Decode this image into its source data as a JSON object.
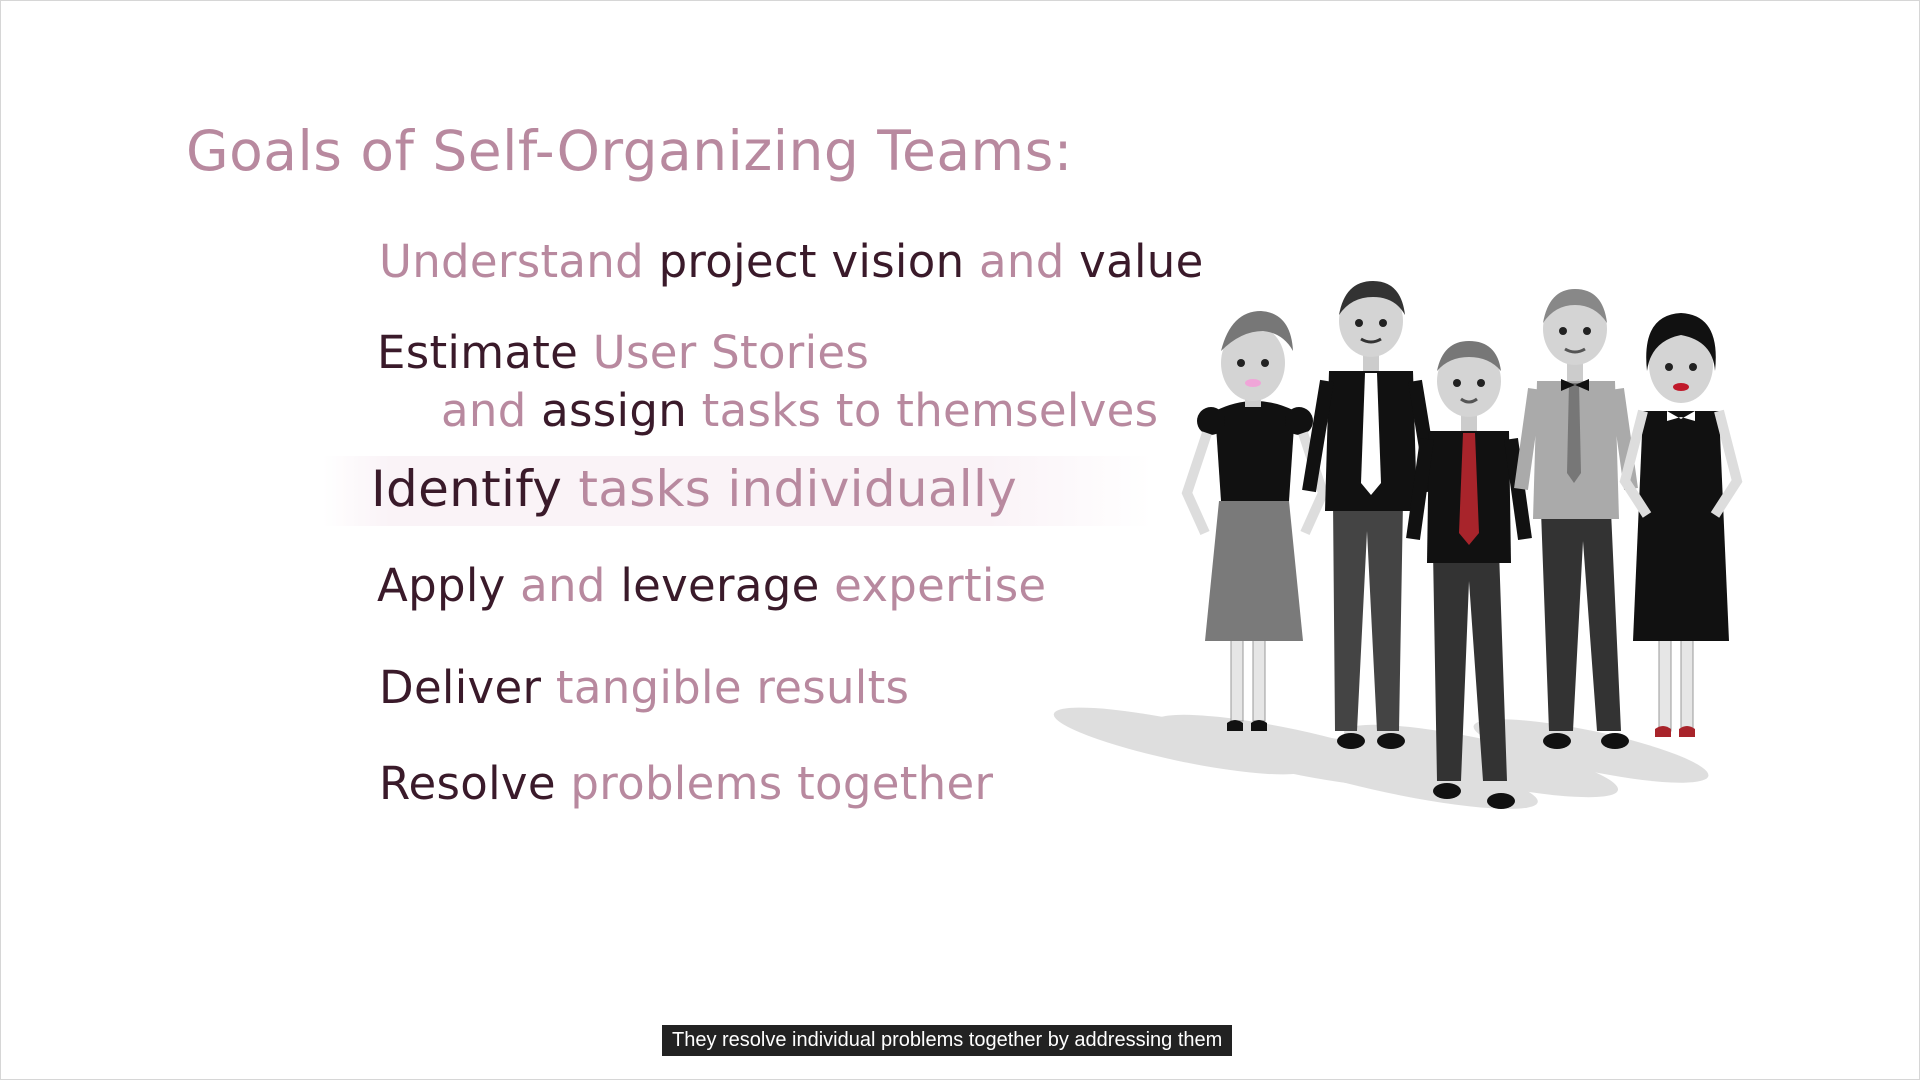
{
  "slide": {
    "title": "Goals of Self-Organizing Teams:",
    "goals": [
      {
        "segments": [
          {
            "text": "Understand",
            "tone": "light"
          },
          {
            "text": " project vision ",
            "tone": "dark"
          },
          {
            "text": "and",
            "tone": "light"
          },
          {
            "text": " value",
            "tone": "dark"
          }
        ]
      },
      {
        "segments": [
          {
            "text": "Estimate",
            "tone": "dark"
          },
          {
            "text": " User Stories",
            "tone": "light"
          }
        ]
      },
      {
        "segments": [
          {
            "text": "and",
            "tone": "light"
          },
          {
            "text": " assign ",
            "tone": "dark"
          },
          {
            "text": "tasks to themselves",
            "tone": "light"
          }
        ]
      },
      {
        "segments": [
          {
            "text": "Identify",
            "tone": "dark"
          },
          {
            "text": " tasks individually",
            "tone": "light"
          }
        ]
      },
      {
        "segments": [
          {
            "text": "Apply",
            "tone": "dark"
          },
          {
            "text": " and ",
            "tone": "light"
          },
          {
            "text": "leverage",
            "tone": "dark"
          },
          {
            "text": " expertise",
            "tone": "light"
          }
        ]
      },
      {
        "segments": [
          {
            "text": "Deliver",
            "tone": "dark"
          },
          {
            "text": " tangible results",
            "tone": "light"
          }
        ]
      },
      {
        "segments": [
          {
            "text": "Resolve",
            "tone": "dark"
          },
          {
            "text": " problems together",
            "tone": "light"
          }
        ]
      }
    ]
  },
  "caption": {
    "text": "They resolve individual problems together by addressing them"
  },
  "colors": {
    "light_text": "#b8899f",
    "dark_text": "#3a1a2a",
    "caption_bg": "#222222"
  },
  "illustration": {
    "subject": "team-of-five-people-illustration"
  }
}
